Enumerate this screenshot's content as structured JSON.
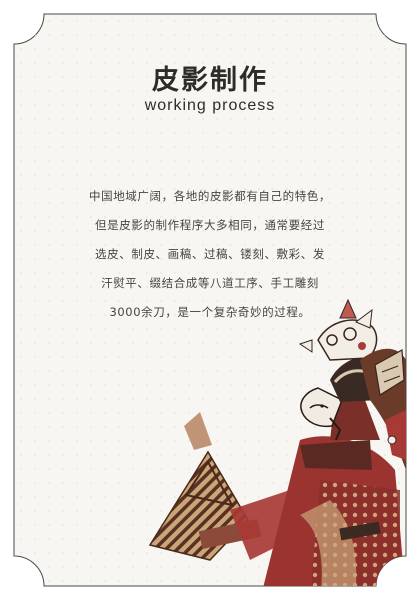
{
  "title": "皮影制作",
  "subtitle": "working process",
  "body_lines": [
    "中国地域广阔，各地的皮影都有自己的特色，",
    "但是皮影的制作程序大多相同，通常要经过",
    "选皮、制皮、画稿、过稿、镂刻、敷彩、发",
    "汗熨平、缀结合成等八道工序、手工雕刻",
    "3000余刀，是一个复杂奇妙的过程。"
  ],
  "colors": {
    "card_background": "#f7f6f2",
    "card_border": "#4a4a4a",
    "title": "#2f2b29",
    "body_text": "#4a4441",
    "puppet_red": "#a83a36",
    "puppet_brown": "#6b3b2a",
    "puppet_tan": "#c9a57a"
  },
  "illustration": {
    "icon": "shadow-puppet-illustration"
  }
}
